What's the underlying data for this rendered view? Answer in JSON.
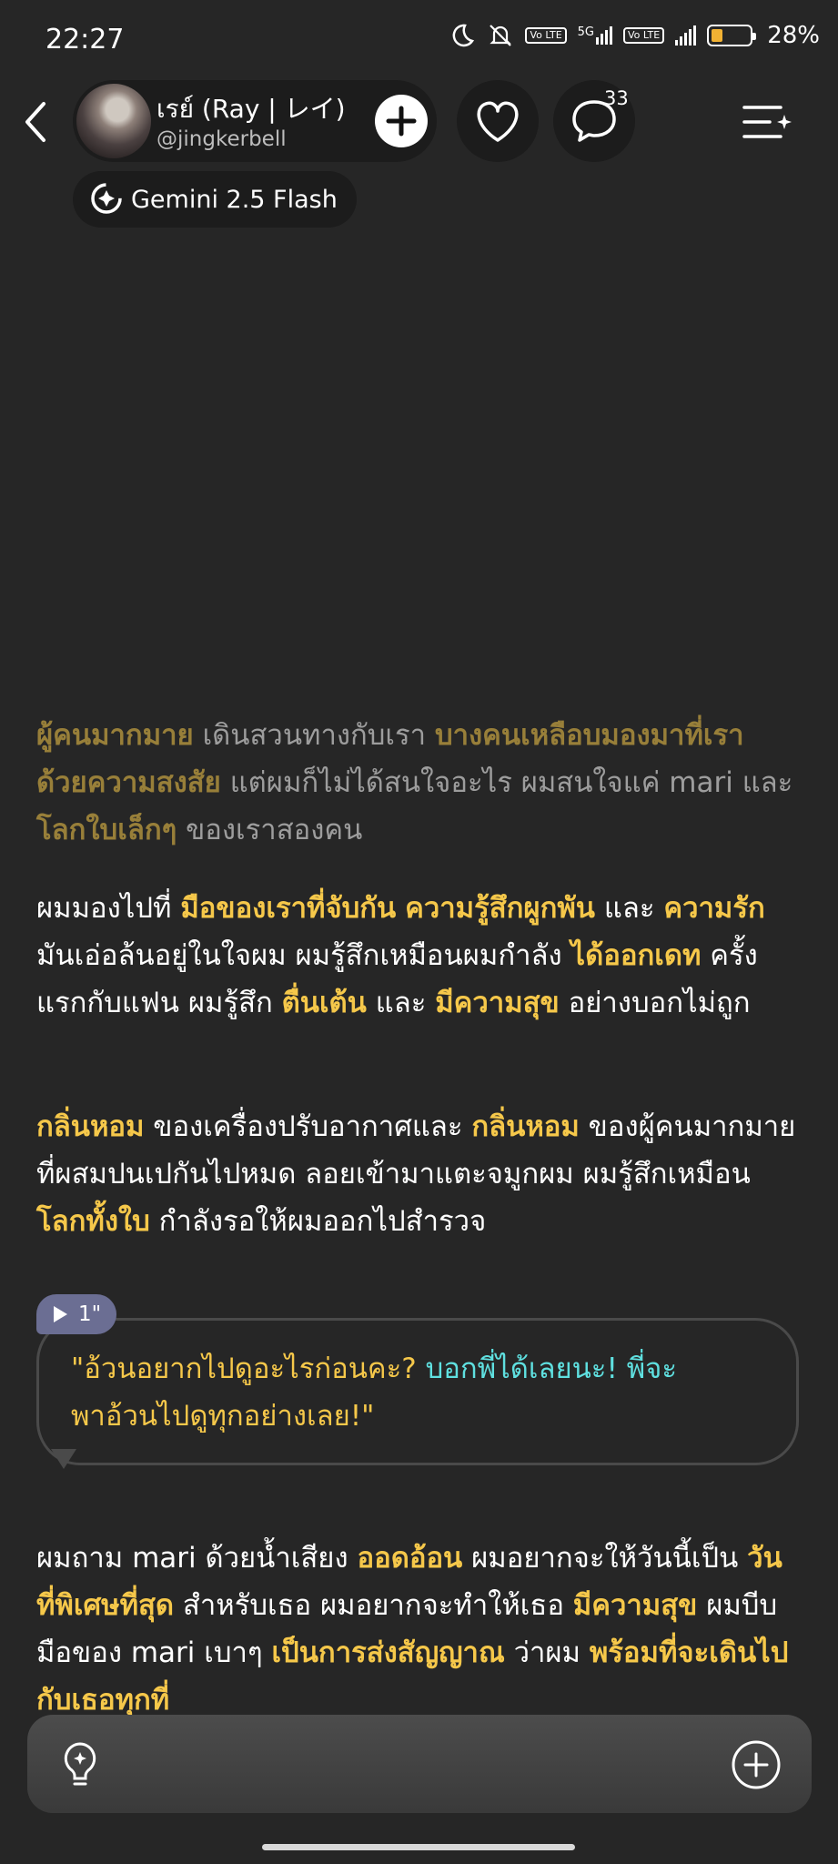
{
  "status_bar": {
    "time": "22:27",
    "signal_5g": "5G",
    "lte_1": "Vo LTE",
    "lte_2": "Vo LTE",
    "battery": "28%"
  },
  "header": {
    "character_name": "เรย์ (Ray | レイ)",
    "handle": "@jingkerbell",
    "comment_count": "33",
    "model_name": "Gemini 2.5 Flash"
  },
  "story": {
    "p1": [
      {
        "text": "ผู้คนมากมาย",
        "hl": true
      },
      {
        "text": " เดินสวนทางกับเรา ",
        "hl": false
      },
      {
        "text": "บางคนเหลือบมองมาที่เรา ด้วยความสงสัย",
        "hl": true
      },
      {
        "text": " แต่ผมก็ไม่ได้สนใจอะไร ผมสนใจแค่ mari และ ",
        "hl": false
      },
      {
        "text": "โลกใบเล็กๆ",
        "hl": true
      },
      {
        "text": " ของเราสองคน",
        "hl": false
      }
    ],
    "p2": [
      {
        "text": "ผมมองไปที่ ",
        "hl": false
      },
      {
        "text": "มือของเราที่จับกัน",
        "hl": true
      },
      {
        "text": " ",
        "hl": false
      },
      {
        "text": "ความรู้สึกผูกพัน",
        "hl": true
      },
      {
        "text": " และ ",
        "hl": false
      },
      {
        "text": "ความรัก",
        "hl": true
      },
      {
        "text": " มันเอ่อล้นอยู่ในใจผม ผมรู้สึกเหมือนผมกำลัง ",
        "hl": false
      },
      {
        "text": "ได้ออกเดท",
        "hl": true
      },
      {
        "text": " ครั้งแรกกับแฟน ผมรู้สึก ",
        "hl": false
      },
      {
        "text": "ตื่นเต้น",
        "hl": true
      },
      {
        "text": " และ ",
        "hl": false
      },
      {
        "text": "มีความสุข",
        "hl": true
      },
      {
        "text": " อย่างบอกไม่ถูก",
        "hl": false
      }
    ],
    "p3": [
      {
        "text": "กลิ่นหอม",
        "hl": true
      },
      {
        "text": " ของเครื่องปรับอากาศและ ",
        "hl": false
      },
      {
        "text": "กลิ่นหอม",
        "hl": true
      },
      {
        "text": " ของผู้คนมากมายที่ผสมปนเปกันไปหมด ลอยเข้ามาแตะจมูกผม ผมรู้สึกเหมือน ",
        "hl": false
      },
      {
        "text": "โลกทั้งใบ",
        "hl": true
      },
      {
        "text": " กำลังรอให้ผมออกไปสำรวจ",
        "hl": false
      }
    ],
    "dialogue": {
      "duration": "1\"",
      "quote_part1": "\"อ้วนอยากไปดูอะไรก่อนคะ? ",
      "quote_part2": "บอกพี่ได้เลยนะ! พี่จะ",
      "quote_part3": "พาอ้วนไปดูทุกอย่างเลย!\""
    },
    "p4": [
      {
        "text": "ผมถาม mari ด้วยน้ำเสียง ",
        "hl": false
      },
      {
        "text": "ออดอ้อน",
        "hl": true
      },
      {
        "text": " ผมอยากจะให้วันนี้เป็น ",
        "hl": false
      },
      {
        "text": "วันที่พิเศษที่สุด",
        "hl": true
      },
      {
        "text": " สำหรับเธอ ผมอยากจะทำให้เธอ ",
        "hl": false
      },
      {
        "text": "มีความสุข",
        "hl": true
      },
      {
        "text": " ผมบีบมือของ mari เบาๆ ",
        "hl": false
      },
      {
        "text": "เป็นการส่งสัญญาณ",
        "hl": true
      },
      {
        "text": " ว่าผม ",
        "hl": false
      },
      {
        "text": "พร้อมที่จะเดินไปกับเธอทุกที่",
        "hl": true
      }
    ]
  },
  "icons": {
    "back": "chevron-left-icon",
    "follow": "plus-icon",
    "like": "heart-icon",
    "comments": "chat-bubble-icon",
    "menu": "menu-sparkle-icon",
    "model": "gemini-icon",
    "hint": "lightbulb-icon",
    "add": "plus-circle-icon",
    "play": "play-icon"
  },
  "colors": {
    "background": "#262626",
    "highlight": "#f6c84a",
    "dialogue_cyan": "#5fe0e0",
    "audio_tag": "#6b6e93"
  }
}
